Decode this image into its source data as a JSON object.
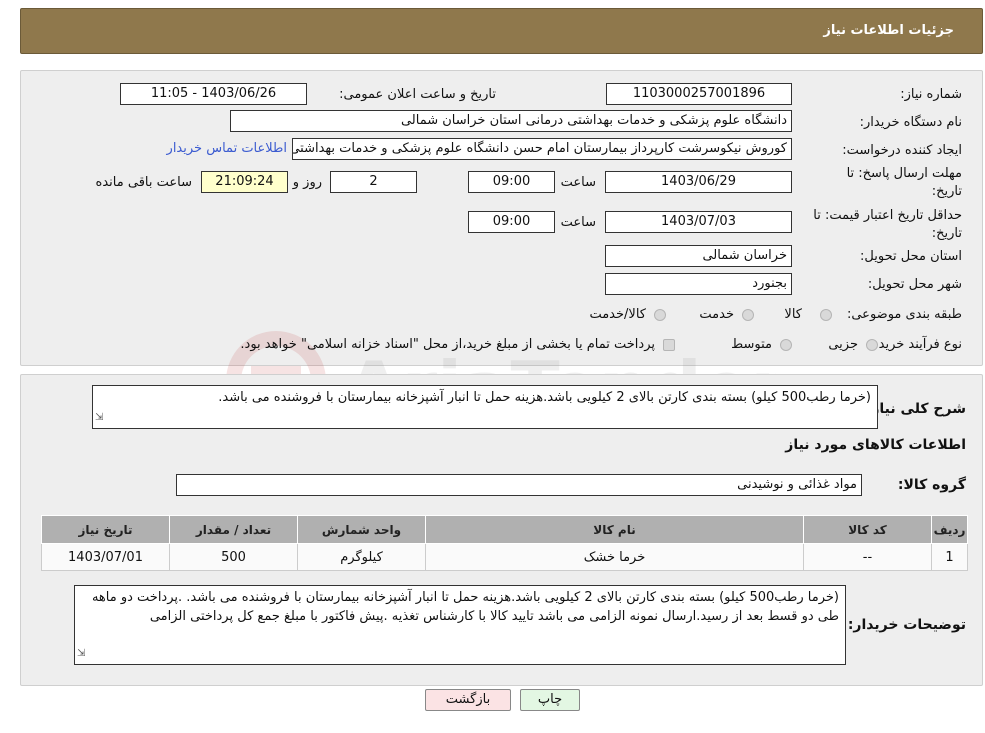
{
  "header": {
    "title": "جزئیات اطلاعات نیاز"
  },
  "info": {
    "need_number_label": "شماره نیاز:",
    "need_number": "1103000257001896",
    "announce_label": "تاریخ و ساعت اعلان عمومی:",
    "announce_value": "1403/06/26 - 11:05",
    "buyer_org_label": "نام دستگاه خریدار:",
    "buyer_org": "دانشگاه علوم پزشکی و خدمات بهداشتی درمانی استان خراسان شمالی",
    "creator_label": "ایجاد کننده درخواست:",
    "creator": "کوروش نیکوسرشت کارپرداز بیمارستان امام حسن دانشگاه علوم پزشکی و خدمات بهداشتی درمانی",
    "contact_link": "اطلاعات تماس خریدار",
    "deadline_label": "مهلت ارسال پاسخ: تا تاریخ:",
    "deadline_date": "1403/06/29",
    "time_label": "ساعت",
    "deadline_time": "09:00",
    "days_value": "2",
    "days_label": "روز و",
    "remaining_time": "21:09:24",
    "remaining_label": "ساعت باقی مانده",
    "validity_label": "حداقل تاریخ اعتبار قیمت: تا تاریخ:",
    "validity_date": "1403/07/03",
    "validity_time": "09:00",
    "province_label": "استان محل تحویل:",
    "province": "خراسان شمالی",
    "city_label": "شهر محل تحویل:",
    "city": "بجنورد",
    "category_label": "طبقه بندی موضوعی:",
    "category_options": [
      "کالا",
      "خدمت",
      "کالا/خدمت"
    ],
    "purchase_type_label": "نوع فرآیند خرید :",
    "purchase_options": [
      "جزیی",
      "متوسط"
    ],
    "payment_note": "پرداخت تمام یا بخشی از مبلغ خرید،از محل \"اسناد خزانه اسلامی\" خواهد بود."
  },
  "details": {
    "general_desc_label": "شرح کلی نیاز:",
    "general_desc": "(خرما رطب500 کیلو) بسته بندی کارتن بالای 2 کیلویی باشد.هزینه حمل تا انبار آشپزخانه بیمارستان با فروشنده می باشد.",
    "items_info_title": "اطلاعات کالاهای مورد نیاز",
    "goods_group_label": "گروه کالا:",
    "goods_group": "مواد غذائی و نوشیدنی",
    "table_headers": [
      "ردیف",
      "کد کالا",
      "نام کالا",
      "واحد شمارش",
      "تعداد / مقدار",
      "تاریخ نیاز"
    ],
    "table_rows": [
      {
        "row": "1",
        "code": "--",
        "name": "خرما خشک",
        "unit": "کیلوگرم",
        "qty": "500",
        "date": "1403/07/01"
      }
    ],
    "buyer_notes_label": "توضیحات خریدار:",
    "buyer_notes": "(خرما رطب500 کیلو) بسته بندی کارتن بالای 2 کیلویی باشد.هزینه حمل تا انبار آشپزخانه بیمارستان با فروشنده می باشد. .پرداخت دو ماهه  طی دو قسط بعد از رسید.ارسال نمونه الزامی می باشد تایید کالا با کارشناس تغذیه .پیش فاکتور با مبلغ جمع کل پرداختی الزامی"
  },
  "buttons": {
    "print": "چاپ",
    "back": "بازگشت"
  },
  "watermark": "AriaTender.neT",
  "colors": {
    "header_bg": "#8f784c",
    "panel_bg": "#eeeeee",
    "link": "#3b5bd0",
    "back_btn_bg": "#fbe3e4",
    "print_btn_bg": "#e3f7e3"
  }
}
